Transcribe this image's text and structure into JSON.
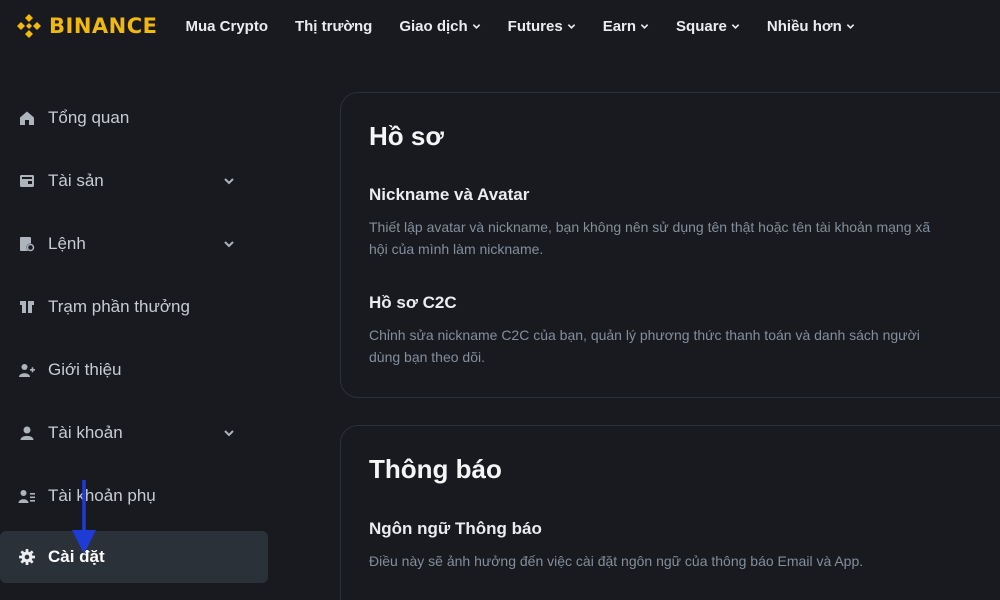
{
  "header": {
    "brand": "BINANCE",
    "nav": [
      {
        "label": "Mua Crypto",
        "dropdown": false
      },
      {
        "label": "Thị trường",
        "dropdown": false
      },
      {
        "label": "Giao dịch",
        "dropdown": true
      },
      {
        "label": "Futures",
        "dropdown": true
      },
      {
        "label": "Earn",
        "dropdown": true
      },
      {
        "label": "Square",
        "dropdown": true
      },
      {
        "label": "Nhiều hơn",
        "dropdown": true
      }
    ]
  },
  "sidebar": {
    "items": [
      {
        "label": "Tổng quan",
        "icon": "home-icon",
        "expandable": false
      },
      {
        "label": "Tài sản",
        "icon": "wallet-icon",
        "expandable": true
      },
      {
        "label": "Lệnh",
        "icon": "orders-icon",
        "expandable": true
      },
      {
        "label": "Trạm phần thưởng",
        "icon": "rewards-icon",
        "expandable": false
      },
      {
        "label": "Giới thiệu",
        "icon": "referral-icon",
        "expandable": false
      },
      {
        "label": "Tài khoản",
        "icon": "account-icon",
        "expandable": true
      },
      {
        "label": "Tài khoản phụ",
        "icon": "sub-account-icon",
        "expandable": false
      },
      {
        "label": "Cài đặt",
        "icon": "gear-icon",
        "expandable": false,
        "active": true
      }
    ]
  },
  "profile_card": {
    "title": "Hồ sơ",
    "sections": [
      {
        "title": "Nickname và Avatar",
        "desc": "Thiết lập avatar và nickname, bạn không nên sử dụng tên thật hoặc tên tài khoản mạng xã hội của mình làm nickname."
      },
      {
        "title": "Hồ sơ C2C",
        "desc": "Chỉnh sửa nickname C2C của bạn, quản lý phương thức thanh toán và danh sách người dùng bạn theo dõi."
      }
    ]
  },
  "notification_card": {
    "title": "Thông báo",
    "sections": [
      {
        "title": "Ngôn ngữ Thông báo",
        "desc": "Điều này sẽ ảnh hưởng đến việc cài đặt ngôn ngữ của thông báo Email và App."
      }
    ]
  },
  "colors": {
    "background": "#181a20",
    "brand": "#f0b90b",
    "active_item": "#2b3139",
    "annotation_arrow": "#1f3bd6"
  }
}
